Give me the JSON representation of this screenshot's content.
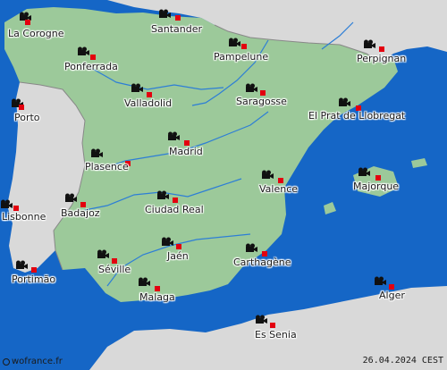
{
  "colors": {
    "sea": "#1566c6",
    "land_spain": "#9cc99a",
    "land_other": "#d9d9d9",
    "border": "#888888",
    "river": "#2d7ed6",
    "city_marker": "#e3000f"
  },
  "cities": [
    {
      "name": "La Corogne",
      "icon": "camera-icon"
    },
    {
      "name": "Santander",
      "icon": "camera-icon"
    },
    {
      "name": "Ponferrada",
      "icon": "camera-icon"
    },
    {
      "name": "Pampelune",
      "icon": "camera-icon"
    },
    {
      "name": "Perpignan",
      "icon": "camera-icon"
    },
    {
      "name": "Porto",
      "icon": "camera-icon"
    },
    {
      "name": "Valladolid",
      "icon": "camera-icon"
    },
    {
      "name": "Saragosse",
      "icon": "camera-icon"
    },
    {
      "name": "El Prat de Llobregat",
      "icon": "camera-icon"
    },
    {
      "name": "Madrid",
      "icon": "camera-icon"
    },
    {
      "name": "Plasence",
      "icon": "camera-icon"
    },
    {
      "name": "Valence",
      "icon": "camera-icon"
    },
    {
      "name": "Majorque",
      "icon": "camera-icon"
    },
    {
      "name": "Lisbonne",
      "icon": "camera-icon"
    },
    {
      "name": "Badajoz",
      "icon": "camera-icon"
    },
    {
      "name": "Ciudad Real",
      "icon": "camera-icon"
    },
    {
      "name": "Jaén",
      "icon": "camera-icon"
    },
    {
      "name": "Carthagène",
      "icon": "camera-icon"
    },
    {
      "name": "Portimão",
      "icon": "camera-icon"
    },
    {
      "name": "Séville",
      "icon": "camera-icon"
    },
    {
      "name": "Malaga",
      "icon": "camera-icon"
    },
    {
      "name": "Alger",
      "icon": "camera-icon"
    },
    {
      "name": "Es Senia",
      "icon": "camera-icon"
    }
  ],
  "footer": {
    "brand": "wofrance.fr",
    "date": "26.04.2024",
    "timezone": "CEST"
  }
}
